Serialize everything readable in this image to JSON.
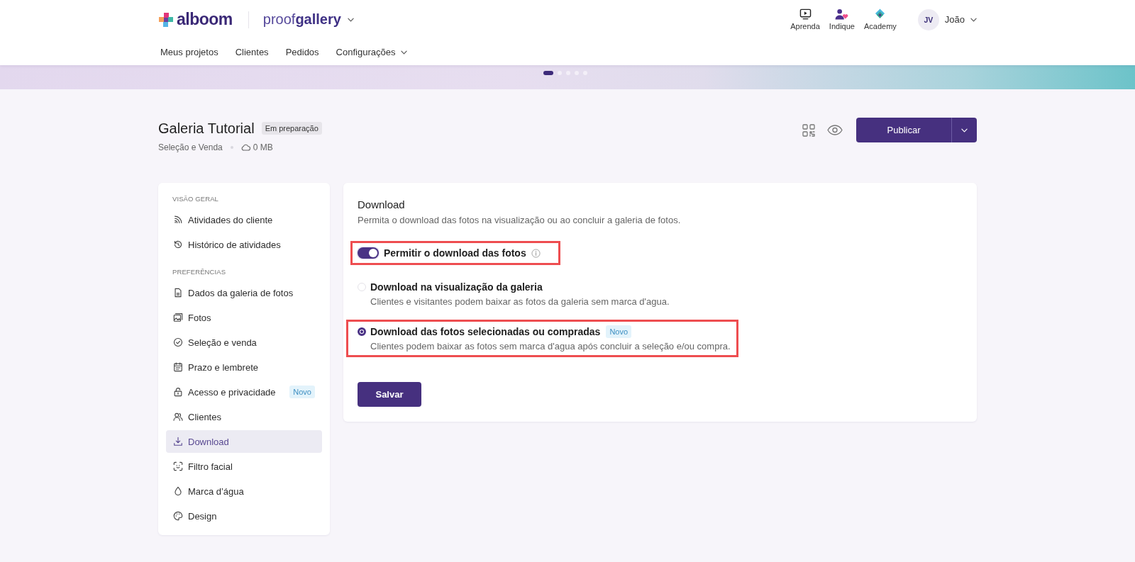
{
  "header": {
    "logo": "alboom",
    "product": "proof**gallery**",
    "nav": [
      {
        "label": "Meus projetos",
        "has_menu": false
      },
      {
        "label": "Clientes",
        "has_menu": false
      },
      {
        "label": "Pedidos",
        "has_menu": false
      },
      {
        "label": "Configurações",
        "has_menu": true
      }
    ],
    "shortcuts": [
      {
        "label": "Aprenda"
      },
      {
        "label": "Indique"
      },
      {
        "label": "Academy"
      }
    ],
    "user": {
      "initials": "JV",
      "name": "João"
    }
  },
  "banner": {
    "dots": [
      {
        "selected": true
      },
      {
        "selected": false
      },
      {
        "selected": false
      },
      {
        "selected": false
      },
      {
        "selected": false
      }
    ]
  },
  "gallery": {
    "title": "Galeria Tutorial",
    "status": "Em preparação",
    "type": "Seleção e Venda",
    "size": "0 MB",
    "primary_action": "Publicar"
  },
  "sidebar": {
    "sections": [
      {
        "heading": "VISÃO GERAL",
        "items": [
          {
            "label": "Atividades do cliente",
            "selected": false
          },
          {
            "label": "Histórico de atividades",
            "selected": false
          }
        ]
      },
      {
        "heading": "PREFERÊNCIAS",
        "items": [
          {
            "label": "Dados da galeria de fotos",
            "selected": false
          },
          {
            "label": "Fotos",
            "selected": false
          },
          {
            "label": "Seleção e venda",
            "selected": false
          },
          {
            "label": "Prazo e lembrete",
            "selected": false
          },
          {
            "label": "Acesso e privacidade",
            "badge": "Novo",
            "selected": false
          },
          {
            "label": "Clientes",
            "selected": false
          },
          {
            "label": "Download",
            "selected": true
          },
          {
            "label": "Filtro facial",
            "selected": false
          },
          {
            "label": "Marca d’água",
            "selected": false
          },
          {
            "label": "Design",
            "selected": false
          }
        ]
      }
    ]
  },
  "panel": {
    "title": "Download",
    "description": "Permita o download das fotos na visualização ou ao concluir a galeria de fotos.",
    "toggle": {
      "label": "Permitir o download das fotos",
      "on": true,
      "highlighted": true
    },
    "options": [
      {
        "label": "Download na visualização da galeria",
        "description": "Clientes e visitantes podem baixar as fotos da galeria sem marca d'agua.",
        "selected": false,
        "highlighted": false
      },
      {
        "label": "Download das fotos selecionadas ou compradas",
        "badge": "Novo",
        "description": "Clientes podem baixar as fotos sem marca d'agua após concluir a seleção e/ou compra.",
        "selected": true,
        "highlighted": true
      }
    ],
    "save": "Salvar"
  }
}
